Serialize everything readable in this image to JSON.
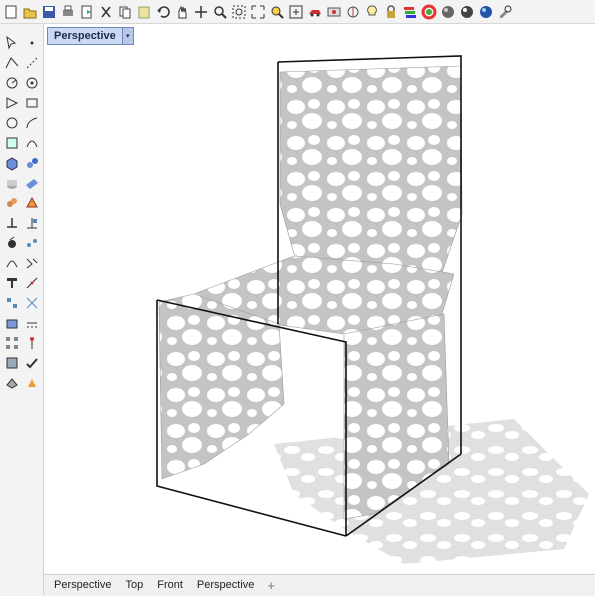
{
  "toolbar": {
    "icons": [
      "new-file-icon",
      "open-folder-icon",
      "save-icon",
      "print-icon",
      "import-icon",
      "cut-icon",
      "copy-icon",
      "paste-icon",
      "undo-icon",
      "pan-hand-icon",
      "move-icon",
      "zoom-icon",
      "zoom-window-icon",
      "zoom-extents-icon",
      "zoom-selected-icon",
      "set-view-icon",
      "car-icon",
      "named-view-icon",
      "named-cplane-icon",
      "light-bulb-icon",
      "lock-icon",
      "layers-icon",
      "color-wheel-icon",
      "shaded-sphere-icon",
      "render-sphere-icon",
      "material-sphere-icon",
      "options-icon"
    ]
  },
  "viewport": {
    "title": "Perspective",
    "dropdown_glyph": "▾"
  },
  "bottom_tabs": [
    "Perspective",
    "Top",
    "Front",
    "Perspective"
  ],
  "add_tab_glyph": "+",
  "colors": {
    "viewport_bg": "#ffffff",
    "model": "#bdbdbd",
    "model_shadow": "#d9d9d9",
    "frame_line": "#111111",
    "tab_active": "#cdd9f2"
  }
}
